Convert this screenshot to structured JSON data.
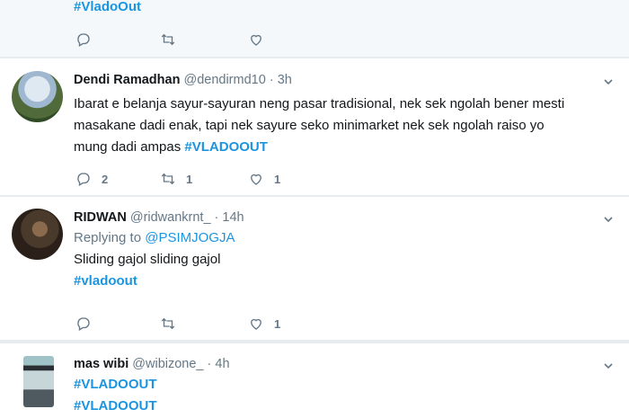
{
  "feed": {
    "tweet0": {
      "hashtag": "#VladoOut",
      "reply_count": "",
      "retweet_count": "",
      "like_count": ""
    },
    "tweet1": {
      "name": "Dendi Ramadhan",
      "handle": "@dendirmd10",
      "dot": "·",
      "time": "3h",
      "text_line1": "Ibarat e belanja sayur-sayuran neng pasar tradisional, nek sek ngolah bener mesti",
      "text_line2": "masakane dadi enak, tapi nek sayure seko minimarket nek sek ngolah raiso yo",
      "text_line3": "mung dadi ampas",
      "hashtag": "#VLADOOUT",
      "reply_count": "2",
      "retweet_count": "1",
      "like_count": "1"
    },
    "tweet2": {
      "name": "RIDWAN",
      "handle": "@ridwankrnt_",
      "dot": "·",
      "time": "14h",
      "replying_label": "Replying to",
      "replying_handle": "@PSIMJOGJA",
      "text": "Sliding gajol sliding gajol",
      "hashtag": "#vladoout",
      "reply_count": "",
      "retweet_count": "",
      "like_count": "1"
    },
    "tweet3": {
      "name": "mas wibi",
      "handle": "@wibizone_",
      "dot": "·",
      "time": "4h",
      "hashtag1": "#VLADOOUT",
      "hashtag2": "#VLADOOUT"
    }
  },
  "colors": {
    "link": "#1b95e0",
    "muted": "#657786",
    "text": "#14171a",
    "divider": "#e6ecf0"
  },
  "icons": [
    "reply-icon",
    "retweet-icon",
    "like-icon",
    "chevron-down-icon"
  ]
}
